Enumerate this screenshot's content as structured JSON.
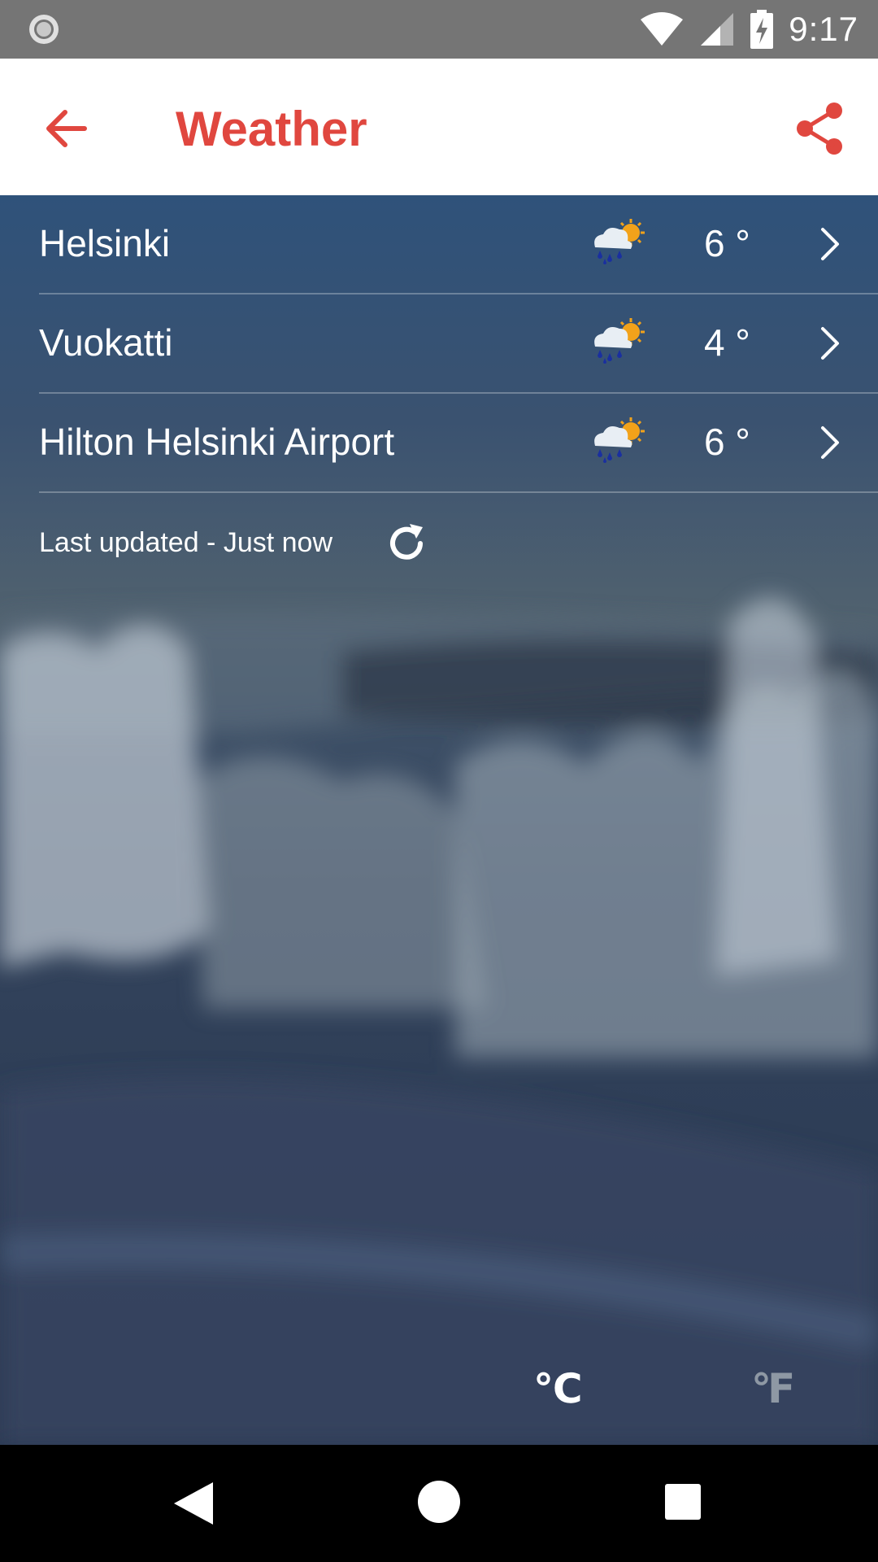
{
  "status_bar": {
    "time": "9:17"
  },
  "app_bar": {
    "title": "Weather",
    "accent_color": "#e0473f"
  },
  "locations": [
    {
      "name": "Helsinki",
      "temp": "6 °",
      "weather_icon": "cloud-rain-sun-icon"
    },
    {
      "name": "Vuokatti",
      "temp": "4 °",
      "weather_icon": "cloud-rain-sun-icon"
    },
    {
      "name": "Hilton Helsinki Airport",
      "temp": "6 °",
      "weather_icon": "cloud-rain-sun-icon"
    }
  ],
  "last_updated": "Last updated - Just now",
  "units": {
    "celsius": "℃",
    "fahrenheit": "℉",
    "selected": "celsius"
  }
}
